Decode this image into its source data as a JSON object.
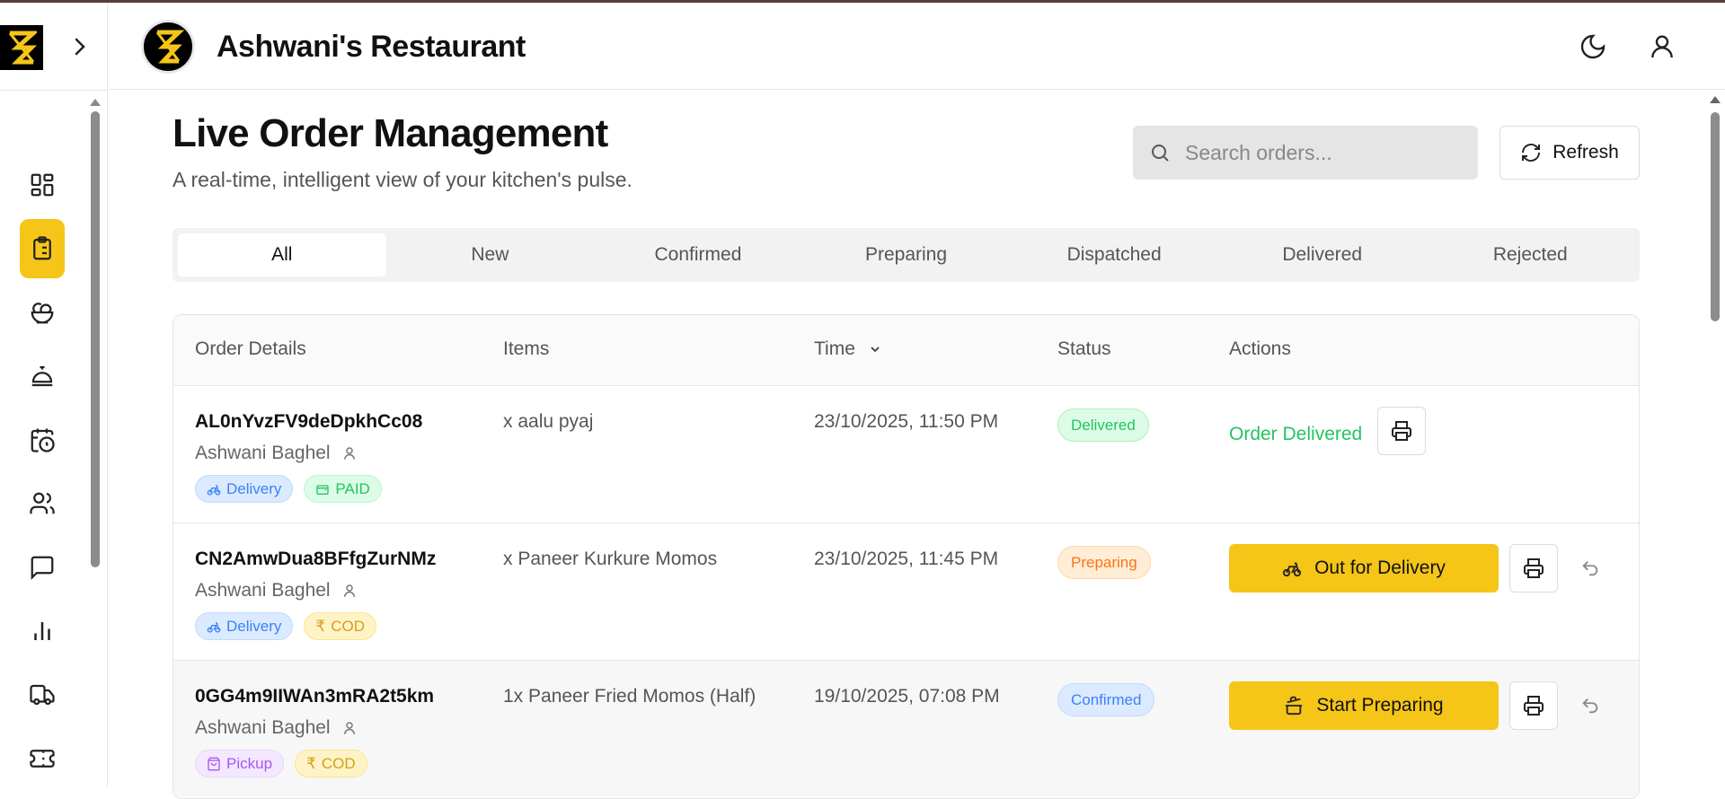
{
  "header": {
    "restaurant_name": "Ashwani's Restaurant"
  },
  "sidebar": {
    "items": [
      {
        "icon": "dashboard-icon"
      },
      {
        "icon": "orders-clipboard-icon",
        "active": true
      },
      {
        "icon": "menu-salad-icon"
      },
      {
        "icon": "service-bell-icon"
      },
      {
        "icon": "calendar-clock-icon"
      },
      {
        "icon": "users-icon"
      },
      {
        "icon": "chat-icon"
      },
      {
        "icon": "analytics-icon"
      },
      {
        "icon": "truck-icon"
      },
      {
        "icon": "ticket-icon"
      }
    ]
  },
  "page": {
    "title": "Live Order Management",
    "subtitle": "A real-time, intelligent view of your kitchen's pulse.",
    "search_placeholder": "Search orders...",
    "refresh_label": "Refresh"
  },
  "tabs": [
    {
      "label": "All",
      "active": true
    },
    {
      "label": "New"
    },
    {
      "label": "Confirmed"
    },
    {
      "label": "Preparing"
    },
    {
      "label": "Dispatched"
    },
    {
      "label": "Delivered"
    },
    {
      "label": "Rejected"
    }
  ],
  "table": {
    "columns": [
      "Order Details",
      "Items",
      "Time",
      "Status",
      "Actions"
    ],
    "rows": [
      {
        "order_id": "AL0nYvzFV9deDpkhCc08",
        "customer": "Ashwani Baghel",
        "type": "Delivery",
        "payment": "PAID",
        "items": "x aalu pyaj",
        "time": "23/10/2025, 11:50 PM",
        "status": "Delivered",
        "action_text": "Order Delivered"
      },
      {
        "order_id": "CN2AmwDua8BFfgZurNMz",
        "customer": "Ashwani Baghel",
        "type": "Delivery",
        "payment": "COD",
        "items": "x Paneer Kurkure Momos",
        "time": "23/10/2025, 11:45 PM",
        "status": "Preparing",
        "action_label": "Out for Delivery"
      },
      {
        "order_id": "0GG4m9IIWAn3mRA2t5km",
        "customer": "Ashwani Baghel",
        "type": "Pickup",
        "payment": "COD",
        "items": "1x Paneer Fried Momos (Half)",
        "time": "19/10/2025, 07:08 PM",
        "status": "Confirmed",
        "action_label": "Start Preparing"
      }
    ]
  },
  "colors": {
    "accent": "#f5c518",
    "delivered": "#22c55e",
    "preparing": "#f97316",
    "confirmed": "#3b82f6"
  }
}
